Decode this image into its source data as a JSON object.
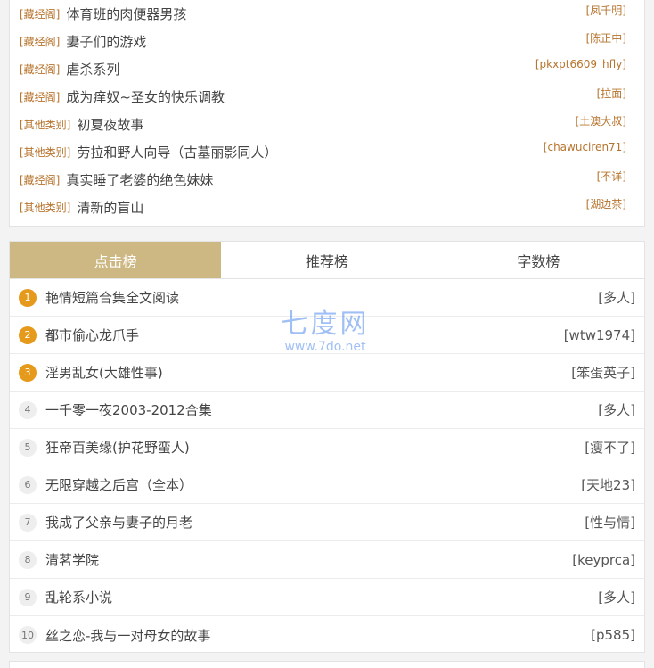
{
  "top_list": [
    {
      "category": "[藏经阁]",
      "title": "体育班的肉便器男孩",
      "author": "[凤千明]"
    },
    {
      "category": "[藏经阁]",
      "title": "妻子们的游戏",
      "author": "[陈正中]"
    },
    {
      "category": "[藏经阁]",
      "title": "虐杀系列",
      "author": "[pkxpt6609_hfly]"
    },
    {
      "category": "[藏经阁]",
      "title": "成为痒奴~圣女的快乐调教",
      "author": "[拉面]"
    },
    {
      "category": "[其他类别]",
      "title": "初夏夜故事",
      "author": "[土澳大叔]"
    },
    {
      "category": "[其他类别]",
      "title": "劳拉和野人向导（古墓丽影同人）",
      "author": "[chawuciren71]"
    },
    {
      "category": "[藏经阁]",
      "title": "真实睡了老婆的绝色妹妹",
      "author": "[不详]"
    },
    {
      "category": "[其他类别]",
      "title": "清新的盲山",
      "author": "[湖边茶]"
    }
  ],
  "rank_tabs": [
    {
      "label": "点击榜",
      "active": true
    },
    {
      "label": "推荐榜",
      "active": false
    },
    {
      "label": "字数榜",
      "active": false
    }
  ],
  "rank_list": [
    {
      "rank": "1",
      "title": "艳情短篇合集全文阅读",
      "author": "[多人]"
    },
    {
      "rank": "2",
      "title": "都市偷心龙爪手",
      "author": "[wtw1974]"
    },
    {
      "rank": "3",
      "title": "淫男乱女(大雄性事)",
      "author": "[笨蛋英子]"
    },
    {
      "rank": "4",
      "title": "一千零一夜2003-2012合集",
      "author": "[多人]"
    },
    {
      "rank": "5",
      "title": "狂帝百美缘(护花野蛮人)",
      "author": "[瘦不了]"
    },
    {
      "rank": "6",
      "title": "无限穿越之后宫（全本）",
      "author": "[天地23]"
    },
    {
      "rank": "7",
      "title": "我成了父亲与妻子的月老",
      "author": "[性与情]"
    },
    {
      "rank": "8",
      "title": "清茗学院",
      "author": "[keyprca]"
    },
    {
      "rank": "9",
      "title": "乱轮系小说",
      "author": "[多人]"
    },
    {
      "rank": "10",
      "title": "丝之恋-我与一对母女的故事",
      "author": "[p585]"
    }
  ],
  "watermark": {
    "logo_text": "七度网",
    "url_text": "www.7do.net"
  },
  "colors": {
    "accent": "#cdb884",
    "category": "#b7742e",
    "rank_hot": "#e69a1c"
  }
}
